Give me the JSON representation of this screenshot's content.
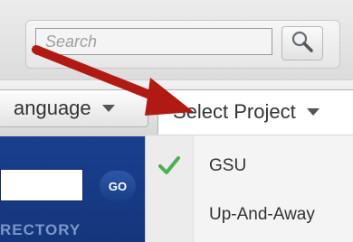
{
  "search": {
    "placeholder": "Search",
    "button_icon": "magnifier-icon"
  },
  "nav": {
    "language_label": "anguage",
    "project_label": "Select Project"
  },
  "sidebar_widget": {
    "go_label": "GO",
    "directory_label": "RECTORY"
  },
  "project_menu": {
    "items": [
      {
        "label": "GSU",
        "selected": true
      },
      {
        "label": "Up-And-Away",
        "selected": false
      }
    ]
  },
  "colors": {
    "arrow": "#b01a12",
    "check": "#4caf50",
    "panel": "#1a3f8f"
  }
}
